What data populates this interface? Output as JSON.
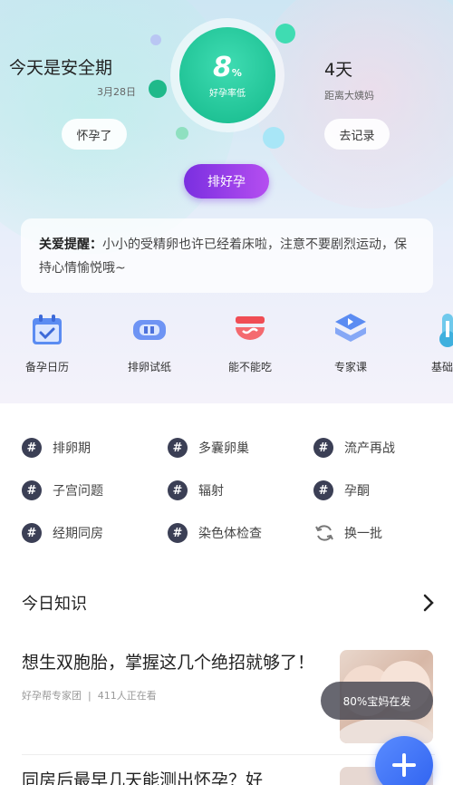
{
  "status": {
    "left_title": "今天是安全期",
    "left_date": "3月28日",
    "center_percent": "8",
    "center_percent_unit": "%",
    "center_label": "好孕率低",
    "right_title": "4天",
    "right_sub": "距离大姨妈"
  },
  "actions": {
    "pregnant_label": "怀孕了",
    "record_label": "去记录",
    "prep_label": "排好孕"
  },
  "tip": {
    "label": "关爱提醒：",
    "text": "小小的受精卵也许已经着床啦，注意不要剧烈运动，保持心情愉悦哦~"
  },
  "tools": [
    {
      "label": "备孕日历",
      "icon": "calendar-icon"
    },
    {
      "label": "排卵试纸",
      "icon": "test-strip-icon"
    },
    {
      "label": "能不能吃",
      "icon": "bowl-icon"
    },
    {
      "label": "专家课",
      "icon": "video-course-icon"
    },
    {
      "label": "基础体",
      "icon": "thermometer-icon"
    }
  ],
  "tags": [
    "排卵期",
    "多囊卵巢",
    "流产再战",
    "子宫问题",
    "辐射",
    "孕酮",
    "经期同房",
    "染色体检查"
  ],
  "refresh_label": "换一批",
  "section": {
    "title": "今日知识"
  },
  "article": {
    "title": "想生双胞胎，掌握这几个绝招就够了！",
    "source": "好孕帮专家团",
    "readers": "411人正在看"
  },
  "article2": {
    "title": "同房后最早几天能测出怀孕？好"
  },
  "toast": "80%宝妈在发",
  "colors": {
    "brand_green": "#14b98b",
    "brand_purple": "#8a35e6",
    "fab_blue": "#2f62f0"
  }
}
